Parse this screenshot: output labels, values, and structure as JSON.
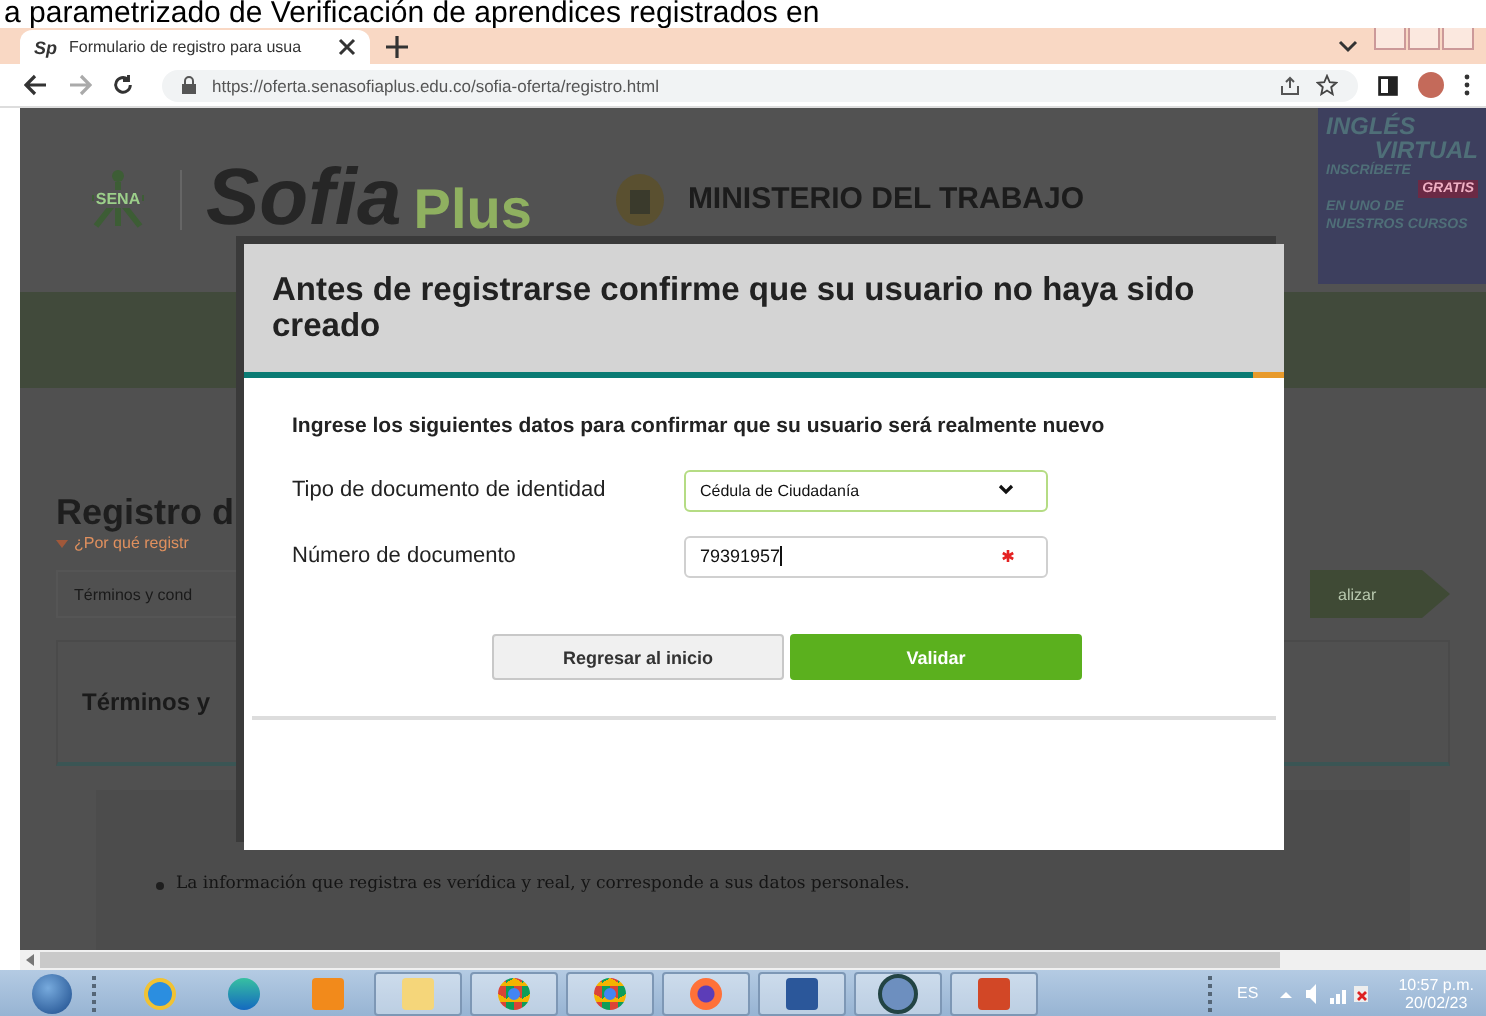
{
  "caption": "a parametrizado de Verificación de aprendices registrados en",
  "browser": {
    "favicon": "Sp",
    "tab_title": "Formulario de registro para usua",
    "url": "https://oferta.senasofiaplus.edu.co/sofia-oferta/registro.html"
  },
  "page": {
    "sena": "SENA",
    "logo_main": "Sofia",
    "logo_plus": "Plus",
    "ministry": "MINISTERIO DEL TRABAJO",
    "promo": [
      "INGLÉS",
      "VIRTUAL",
      "INSCRÍBETE",
      "GRATIS",
      "EN UNO DE",
      "NUESTROS  CURSOS"
    ],
    "heading": "Registro d",
    "why_link": "¿Por qué registr",
    "terms_field": "Términos y cond",
    "step": "alizar",
    "terms_heading": "Términos y",
    "bullet": "La información que registra es verídica y real, y corresponde a sus datos personales."
  },
  "modal": {
    "title": "Antes de registrarse confirme que su usuario no haya sido creado",
    "instruction": "Ingrese los siguientes datos para confirmar que su usuario será realmente nuevo",
    "fields": [
      {
        "label": "Tipo de documento de identidad",
        "kind": "select",
        "value": "Cédula de Ciudadanía",
        "required": false
      },
      {
        "label": "Número de documento",
        "kind": "input",
        "value": "79391957",
        "required": true
      }
    ],
    "buttons": [
      {
        "label": "Regresar al inicio",
        "kind": "secondary"
      },
      {
        "label": "Validar",
        "kind": "primary"
      }
    ]
  },
  "tray": {
    "language": "ES",
    "time": "10:57 p.m.",
    "date": "20/02/23"
  }
}
